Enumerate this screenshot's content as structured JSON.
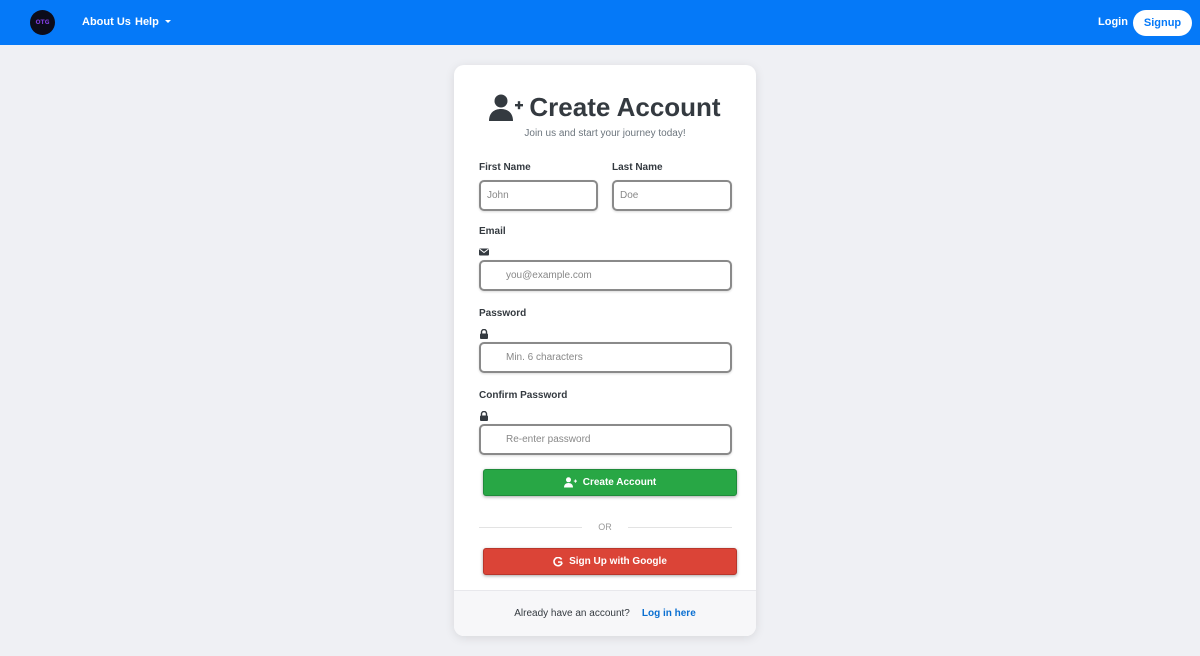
{
  "navbar": {
    "logo_text": "OTG",
    "about_label": "About Us",
    "help_label": "Help",
    "login_label": "Login",
    "signup_label": "Signup",
    "bg_color": "#0579f8"
  },
  "card": {
    "title": "Create Account",
    "title_icon": "user-plus-icon",
    "subtitle": "Join us and start your journey today!",
    "first_name": {
      "label": "First Name",
      "placeholder": "John",
      "value": ""
    },
    "last_name": {
      "label": "Last Name",
      "placeholder": "Doe",
      "value": ""
    },
    "email": {
      "label": "Email",
      "icon": "envelope-icon",
      "placeholder": "you@example.com",
      "value": ""
    },
    "password": {
      "label": "Password",
      "icon": "lock-icon",
      "placeholder": "Min. 6 characters",
      "value": ""
    },
    "confirm_password": {
      "label": "Confirm Password",
      "icon": "lock-icon",
      "placeholder": "Re-enter password",
      "value": ""
    },
    "create_button": {
      "label": "Create Account",
      "icon": "user-plus-icon",
      "color": "#28a745"
    },
    "divider_text": "OR",
    "google_button": {
      "label": "Sign Up with Google",
      "icon": "google-icon",
      "color": "#db4437"
    },
    "footer": {
      "text": "Already have an account?",
      "link": "Log in here"
    }
  }
}
